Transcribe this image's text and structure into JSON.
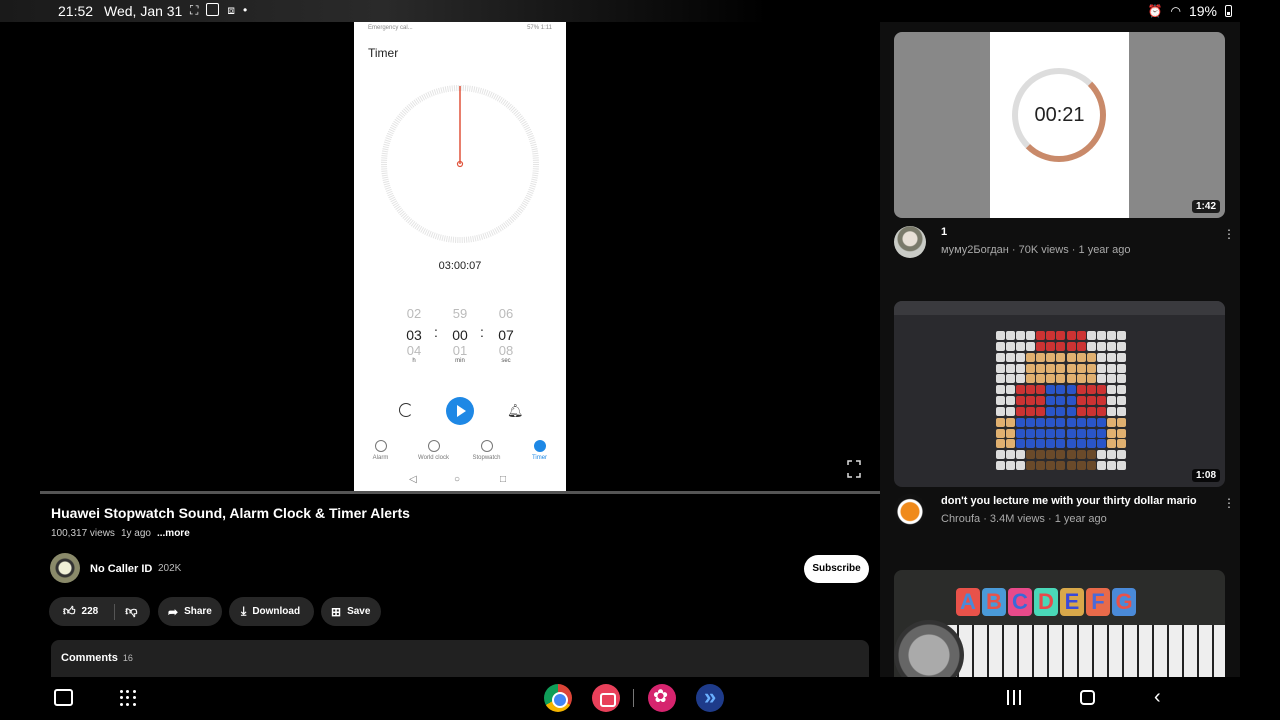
{
  "status_bar": {
    "time": "21:52",
    "date": "Wed, Jan 31",
    "battery": "19%"
  },
  "phone": {
    "status_left": "Emergency cal...",
    "status_right": "57% 1:11",
    "title": "Timer",
    "set_time": "03:00:07",
    "picker": {
      "hours": {
        "prev": "02",
        "current": "03",
        "next": "04",
        "unit": "h"
      },
      "minutes": {
        "prev": "59",
        "current": "00",
        "next": "01",
        "unit": "min"
      },
      "seconds": {
        "prev": "06",
        "current": "07",
        "next": "08",
        "unit": "sec"
      }
    },
    "nav": [
      {
        "label": "Alarm"
      },
      {
        "label": "World clock"
      },
      {
        "label": "Stopwatch"
      },
      {
        "label": "Timer"
      }
    ]
  },
  "video": {
    "title": "Huawei Stopwatch Sound, Alarm Clock & Timer Alerts",
    "views": "100,317 views",
    "age": "1y ago",
    "more": "...more",
    "channel": "No Caller ID",
    "subscribers": "202K",
    "subscribe_label": "Subscribe",
    "likes": "228",
    "share_label": "Share",
    "download_label": "Download",
    "save_label": "Save",
    "comments_label": "Comments",
    "comments_count": "16"
  },
  "recommendations": [
    {
      "thumb_text": "00:21",
      "duration": "1:42",
      "title": "1",
      "meta": "муму2Богдан · 70K views · 1 year ago"
    },
    {
      "duration": "1:08",
      "title": "don't you lecture me with your thirty dollar mario",
      "meta": "Chroufa · 3.4M views · 1 year ago"
    },
    {
      "thumb_letters": [
        "A",
        "B",
        "C",
        "D",
        "E",
        "F",
        "G"
      ]
    }
  ],
  "colors": {
    "accent_blue": "#1e88e5",
    "subscribe_bg": "#ffffff",
    "pill_bg": "#272727",
    "timer_hand": "#e0523a"
  }
}
